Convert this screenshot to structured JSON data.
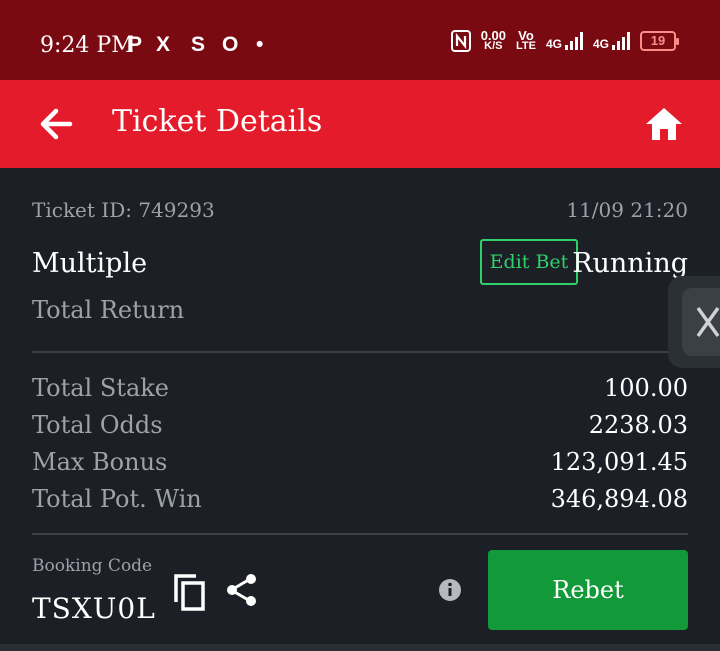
{
  "status_bar": {
    "time": "9:24 PM",
    "app_icons": [
      "P",
      "X",
      "S",
      "O",
      "•"
    ],
    "net_speed_value": "0.00",
    "net_speed_unit": "K/S",
    "volte_top": "Vo",
    "volte_bottom": "LTE",
    "sim1": "4G",
    "sim2": "4G",
    "battery": "19"
  },
  "app_bar": {
    "title": "Ticket Details",
    "back_icon": "arrow-left-icon",
    "home_icon": "home-icon"
  },
  "ticket": {
    "id_label": "Ticket ID: 749293",
    "date": "11/09 21:20",
    "bet_type": "Multiple",
    "edit_bet_label": "Edit Bet",
    "status": "Running",
    "total_return_label": "Total Return",
    "rows": [
      {
        "label": "Total Stake",
        "value": "100.00"
      },
      {
        "label": "Total Odds",
        "value": "2238.03"
      },
      {
        "label": "Max Bonus",
        "value": "123,091.45"
      },
      {
        "label": "Total Pot. Win",
        "value": "346,894.08"
      }
    ],
    "booking_label": "Booking Code",
    "booking_code": "TSXU0L",
    "rebet_label": "Rebet"
  },
  "colors": {
    "status_bar": "#7a0a12",
    "app_bar": "#e41b2a",
    "background": "#1c2026",
    "edit_bet": "#2fd06a",
    "rebet": "#12993a"
  }
}
